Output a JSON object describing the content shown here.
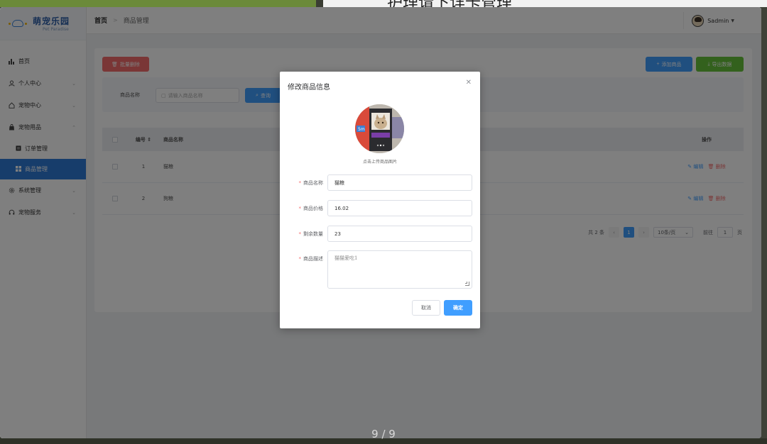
{
  "background": {
    "title_fragment": "护理请下详卡管理",
    "slide_counter": "9 / 9"
  },
  "app": {
    "logo": {
      "name": "萌宠乐园",
      "subtitle": "Pet Paradise"
    },
    "sidebar": {
      "items": [
        {
          "label": "首页",
          "icon": "bar-chart-icon"
        },
        {
          "label": "个人中心",
          "icon": "user-icon"
        },
        {
          "label": "宠物中心",
          "icon": "home-icon"
        },
        {
          "label": "宠物用品",
          "icon": "bag-icon"
        },
        {
          "label": "订单管理",
          "icon": "order-icon"
        },
        {
          "label": "商品管理",
          "icon": "grid-icon"
        },
        {
          "label": "系统管理",
          "icon": "gear-icon"
        },
        {
          "label": "宠物服务",
          "icon": "headset-icon"
        }
      ]
    },
    "breadcrumb": {
      "home": "首页",
      "current": "商品管理"
    },
    "user": {
      "name": "Sadmin"
    },
    "toolbar": {
      "batch_delete": "批量删除",
      "add": "添加商品",
      "export": "导出数据"
    },
    "search": {
      "label": "商品名称",
      "placeholder": "请输入商品名称",
      "button": "查询"
    },
    "table": {
      "headers": {
        "index": "编号",
        "name": "商品名称",
        "ops": "操作"
      },
      "rows": [
        {
          "index": "1",
          "name": "猫粮",
          "edit": "编辑",
          "del": "删除"
        },
        {
          "index": "2",
          "name": "狗粮",
          "edit": "编辑",
          "del": "删除"
        }
      ]
    },
    "pager": {
      "total": "共 2 条",
      "page": "1",
      "size": "10条/页",
      "goto": "前往",
      "goto_value": "1",
      "unit": "页"
    }
  },
  "dialog": {
    "title": "修改商品信息",
    "upload_hint": "点击上传商品图片",
    "fields": {
      "name": {
        "label": "商品名称",
        "value": "猫粮"
      },
      "price": {
        "label": "商品价格",
        "value": "16.02"
      },
      "stock": {
        "label": "剩余数量",
        "value": "23"
      },
      "desc": {
        "label": "商品描述",
        "value": "猫猫爱吃1"
      }
    },
    "cancel": "取消",
    "confirm": "确定"
  },
  "colors": {
    "primary": "#409eff",
    "danger": "#f56c6c",
    "success": "#67c23a",
    "nav_active": "#2f7ad6"
  }
}
